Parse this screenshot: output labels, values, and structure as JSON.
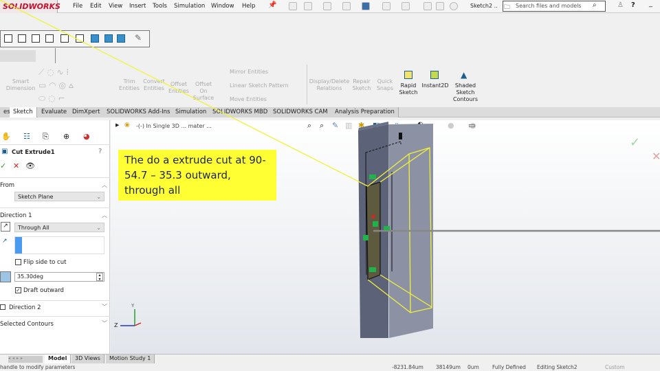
{
  "app": {
    "logo": "SOLIDWORKS",
    "menu": [
      "File",
      "Edit",
      "View",
      "Insert",
      "Tools",
      "Simulation",
      "Window",
      "Help"
    ],
    "doc_name": "Sketch2 ..",
    "search_placeholder": "Search files and models"
  },
  "ribbon": {
    "items": [
      {
        "label": "Smart\nDimension",
        "enabled": false
      },
      {
        "label": "Trim\nEntities",
        "enabled": false
      },
      {
        "label": "Convert\nEntities",
        "enabled": false
      },
      {
        "label": "Offset\nEntities",
        "enabled": false
      },
      {
        "label": "Offset\nOn\nSurface",
        "enabled": false
      },
      {
        "label": "Display/Delete\nRelations",
        "enabled": false
      },
      {
        "label": "Repair\nSketch",
        "enabled": false
      },
      {
        "label": "Quick\nSnaps",
        "enabled": false
      },
      {
        "label": "Rapid\nSketch",
        "enabled": true
      },
      {
        "label": "Instant2D",
        "enabled": true
      },
      {
        "label": "Shaded\nSketch\nContours",
        "enabled": true
      }
    ],
    "mirror": "Mirror Entities",
    "linear": "Linear Sketch Pattern",
    "move": "Move Entities"
  },
  "tabs": [
    "es",
    "Sketch",
    "Evaluate",
    "DimXpert",
    "SOLIDWORKS Add-Ins",
    "Simulation",
    "SOLIDWORKS MBD",
    "SOLIDWORKS CAM",
    "Analysis Preparation"
  ],
  "active_tab": "Sketch",
  "tree_title": "-(-) In Single 3D ... mater ...",
  "panel": {
    "title": "Cut Extrude1",
    "from_label": "From",
    "from_value": "Sketch Plane",
    "dir1_label": "Direction 1",
    "dir1_value": "Through All",
    "flip_label": "Flip side to cut",
    "flip_checked": false,
    "draft_value": "35.30deg",
    "draft_outward_label": "Draft outward",
    "draft_outward_checked": true,
    "dir2_label": "Direction 2",
    "contours_label": "Selected Contours"
  },
  "callout": "The do a extrude cut at 90-54.7 – 35.3 outward, through all",
  "triad": {
    "y": "Y",
    "z": "Z"
  },
  "bottom_tabs": [
    "Model",
    "3D Views",
    "Motion Study 1"
  ],
  "status": {
    "hint": "handle to modify parameters",
    "x": "-8231.84um",
    "y": "38149um",
    "z": "0um",
    "state": "Fully Defined",
    "editing": "Editing Sketch2",
    "units": "Custom"
  },
  "colors": {
    "brand": "#c8102e",
    "callout_bg": "#ffff33",
    "sketch_yellow": "#f2f23a",
    "relation_green": "#22b24c"
  }
}
